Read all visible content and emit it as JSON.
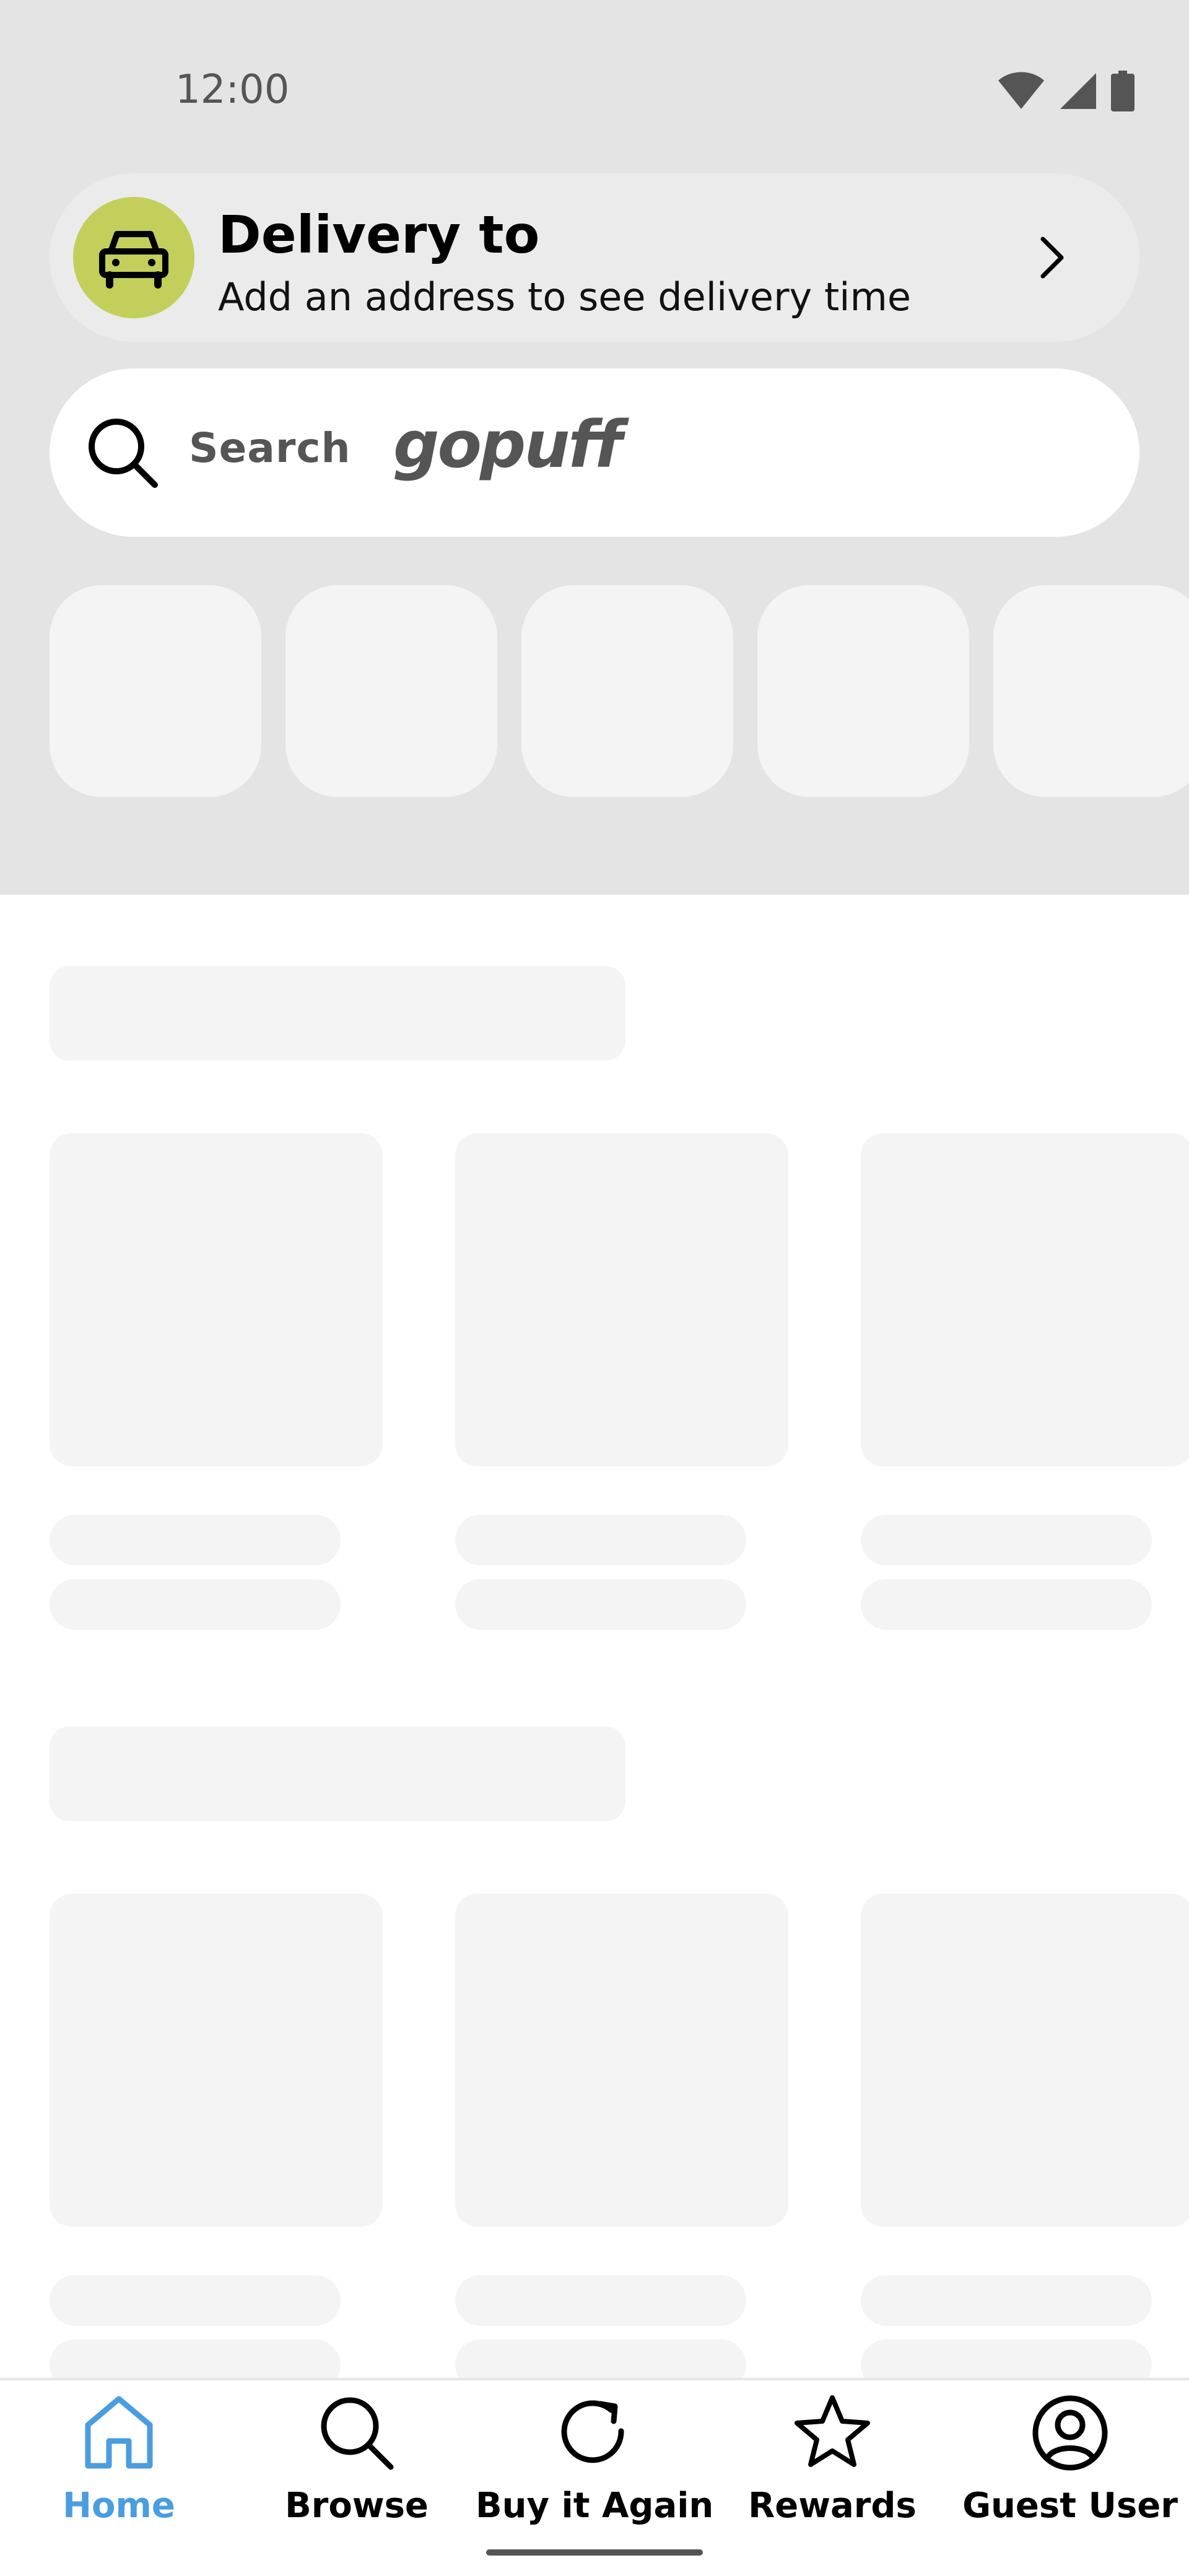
{
  "status_bar": {
    "time": "12:00",
    "icons": [
      "wifi-icon",
      "cell-signal-icon",
      "battery-icon"
    ]
  },
  "delivery": {
    "title": "Delivery to",
    "subtitle": "Add an address to see delivery time",
    "icon": "car-icon",
    "accent_color": "#c3cf5a"
  },
  "search": {
    "label": "Search",
    "brand": "gopuff",
    "icon": "search-icon"
  },
  "bottom_nav": {
    "items": [
      {
        "label": "Home",
        "icon": "home-icon",
        "active": true
      },
      {
        "label": "Browse",
        "icon": "search-icon",
        "active": false
      },
      {
        "label": "Buy it Again",
        "icon": "reorder-icon",
        "active": false
      },
      {
        "label": "Rewards",
        "icon": "star-icon",
        "active": false
      },
      {
        "label": "Guest User",
        "icon": "user-icon",
        "active": false
      }
    ],
    "active_color": "#4a9de0"
  }
}
